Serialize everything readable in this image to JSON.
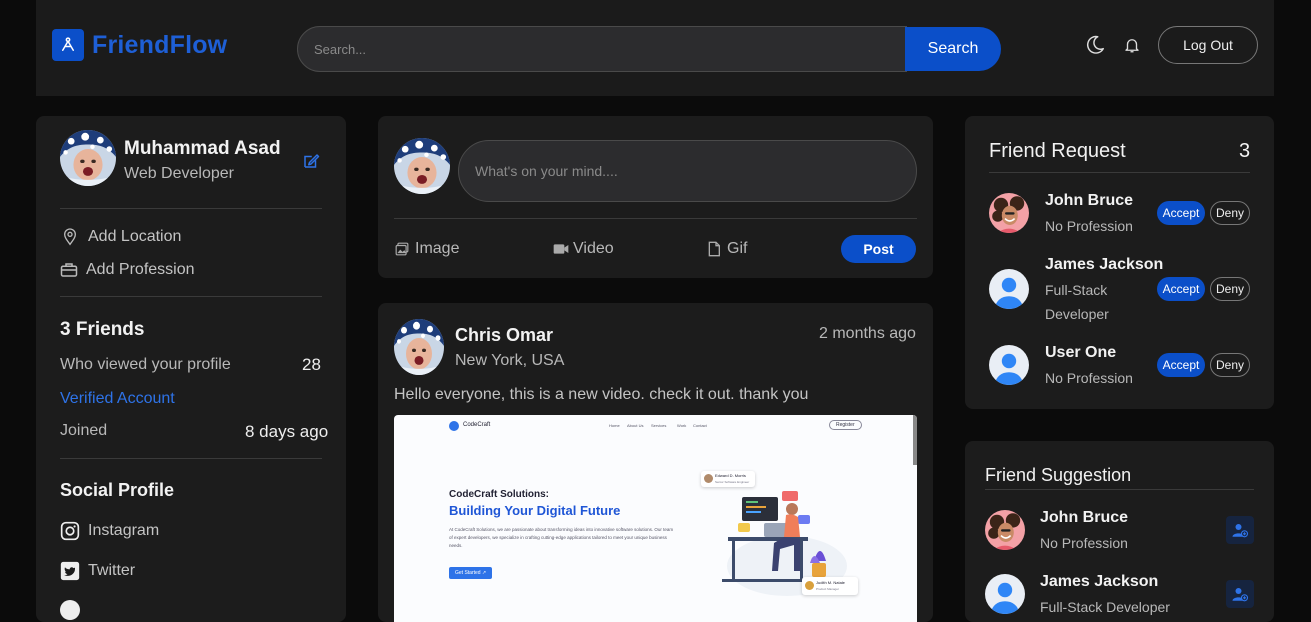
{
  "header": {
    "brand": "FriendFlow",
    "search_placeholder": "Search...",
    "search_button": "Search",
    "logout": "Log Out"
  },
  "profile": {
    "name": "Muhammad Asad",
    "title": "Web Developer",
    "add_location": "Add Location",
    "add_profession": "Add Profession",
    "friends": "3 Friends",
    "viewed_label": "Who viewed your profile",
    "viewed_count": "28",
    "verified": "Verified Account",
    "joined_label": "Joined",
    "joined_value": "8 days ago",
    "social_title": "Social Profile",
    "social": [
      "Instagram",
      "Twitter"
    ]
  },
  "composer": {
    "placeholder": "What's on your mind....",
    "image": "Image",
    "video": "Video",
    "gif": "Gif",
    "post": "Post"
  },
  "post": {
    "author": "Chris Omar",
    "location": "New York, USA",
    "time": "2 months ago",
    "text": "Hello everyone, this is a new video. check it out. thank you",
    "preview": {
      "brand": "CodeCraft",
      "nav": [
        "Home",
        "About Us",
        "Services",
        "Work",
        "Contact"
      ],
      "register": "Register",
      "kicker": "CodeCraft Solutions:",
      "headline": "Building Your Digital Future",
      "body": "At CodeCraft Solutions, we are passionate about transforming ideas into innovative software solutions. Our team of expert developers, we specialize in crafting cutting-edge applications tailored to meet your unique business needs.",
      "cta": "Get Started ↗",
      "badge1_name": "Edward D. Morris",
      "badge1_role": "Senior Software Engineer",
      "badge2_name": "Judith M. Natale",
      "badge2_role": "Product Manager"
    }
  },
  "friend_requests": {
    "title": "Friend Request",
    "count": "3",
    "accept": "Accept",
    "deny": "Deny",
    "items": [
      {
        "name": "John Bruce",
        "profession": "No Profession"
      },
      {
        "name": "James Jackson",
        "profession": "Full-Stack",
        "profession2": "Developer"
      },
      {
        "name": "User One",
        "profession": "No Profession"
      }
    ]
  },
  "suggestions": {
    "title": "Friend Suggestion",
    "items": [
      {
        "name": "John Bruce",
        "profession": "No Profession"
      },
      {
        "name": "James Jackson",
        "profession": "Full-Stack Developer"
      }
    ]
  },
  "colors": {
    "accent": "#0b4fc9",
    "bg": "#0b0b0b",
    "card": "#1c1c1c",
    "link": "#2e73e8"
  }
}
